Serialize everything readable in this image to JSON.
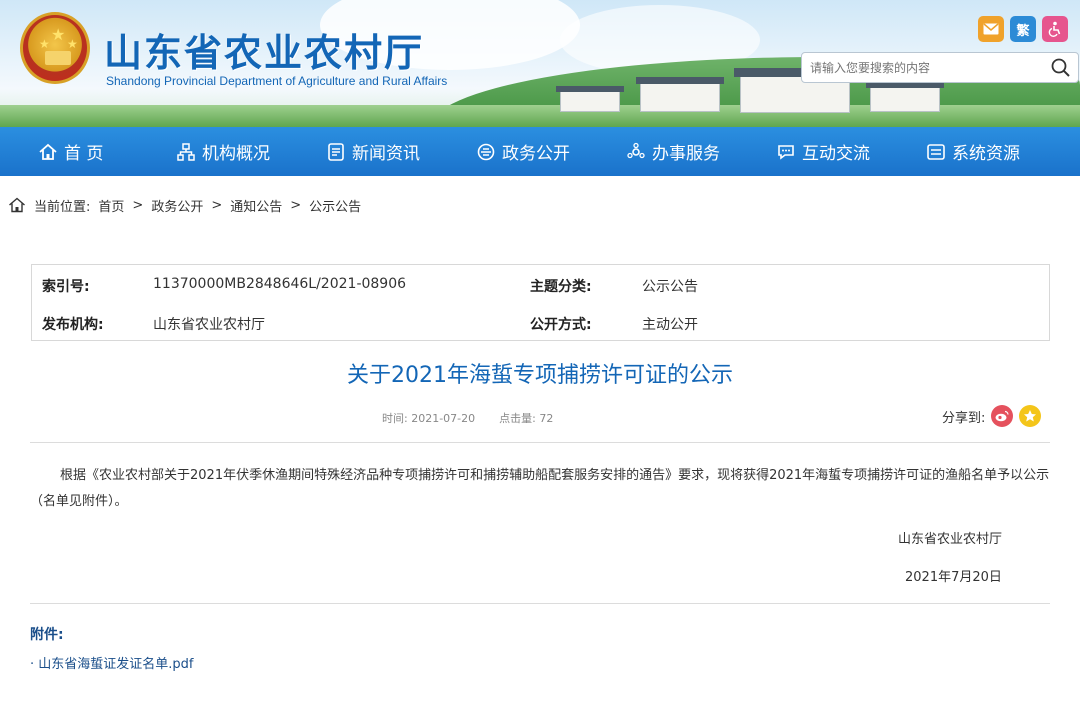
{
  "header": {
    "site_title": "山东省农业农村厅",
    "site_subtitle": "Shandong Provincial Department of Agriculture and Rural Affairs",
    "icons": [
      "mail-icon",
      "traditional-chinese-icon",
      "accessibility-icon"
    ],
    "trad_label": "繁",
    "search_placeholder": "请输入您要搜索的内容"
  },
  "nav": {
    "items": [
      {
        "label": "首 页",
        "icon": "home-icon"
      },
      {
        "label": "机构概况",
        "icon": "org-icon"
      },
      {
        "label": "新闻资讯",
        "icon": "news-icon"
      },
      {
        "label": "政务公开",
        "icon": "gov-icon"
      },
      {
        "label": "办事服务",
        "icon": "service-icon"
      },
      {
        "label": "互动交流",
        "icon": "chat-icon"
      },
      {
        "label": "系统资源",
        "icon": "system-icon"
      }
    ]
  },
  "breadcrumb": {
    "label": "当前位置:",
    "items": [
      "首页",
      "政务公开",
      "通知公告",
      "公示公告"
    ],
    "separator": ">"
  },
  "meta": {
    "index_label": "索引号:",
    "index_value": "11370000MB2848646L/2021-08906",
    "topic_label": "主题分类:",
    "topic_value": "公示公告",
    "issuer_label": "发布机构:",
    "issuer_value": "山东省农业农村厅",
    "disclosure_label": "公开方式:",
    "disclosure_value": "主动公开"
  },
  "article": {
    "title": "关于2021年海蜇专项捕捞许可证的公示",
    "time_label": "时间:",
    "time_value": "2021-07-20",
    "clicks_label": "点击量:",
    "clicks_value": "72",
    "share_label": "分享到:",
    "body": "根据《农业农村部关于2021年伏季休渔期间特殊经济品种专项捕捞许可和捕捞辅助船配套服务安排的通告》要求，现将获得2021年海蜇专项捕捞许可证的渔船名单予以公示（名单见附件）。",
    "signature": "山东省农业农村厅",
    "date": "2021年7月20日"
  },
  "attachments": {
    "label": "附件:",
    "files": [
      "· 山东省海蜇证发证名单.pdf"
    ]
  },
  "colors": {
    "brand_blue": "#1366b6",
    "nav_blue": "#2b8fe0",
    "weibo_red": "#e5515d",
    "qzone_yellow": "#f4c51a"
  }
}
